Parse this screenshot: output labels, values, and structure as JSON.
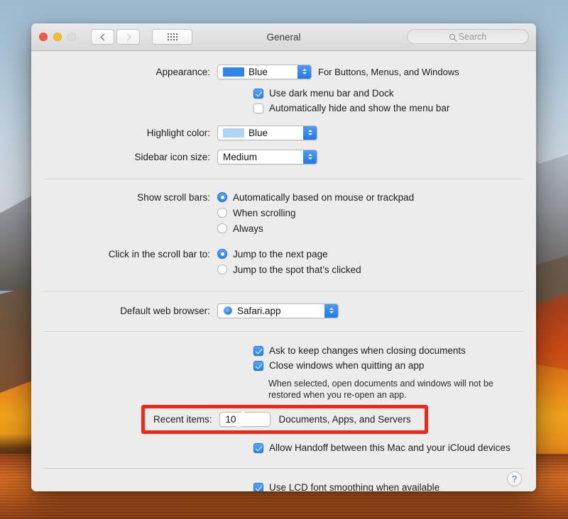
{
  "window": {
    "title": "General",
    "traffic_lights": [
      "close",
      "minimize",
      "zoom"
    ],
    "nav": {
      "back_icon": "chevron-left-icon",
      "forward_icon": "chevron-right-icon"
    },
    "show_all_icon": "grid-dots-icon",
    "search": {
      "placeholder": "Search",
      "value": "",
      "icon": "search-icon"
    }
  },
  "appearance": {
    "label": "Appearance:",
    "value": "Blue",
    "swatch_color": "#2d87e8",
    "hint": "For Buttons, Menus, and Windows",
    "dark_menu_bar": {
      "label": "Use dark menu bar and Dock",
      "checked": true
    },
    "auto_hide_menu_bar": {
      "label": "Automatically hide and show the menu bar",
      "checked": false
    }
  },
  "highlight_color": {
    "label": "Highlight color:",
    "value": "Blue",
    "swatch_color": "#b0d3f5"
  },
  "sidebar_icon_size": {
    "label": "Sidebar icon size:",
    "value": "Medium"
  },
  "show_scroll_bars": {
    "label": "Show scroll bars:",
    "options": [
      {
        "label": "Automatically based on mouse or trackpad",
        "selected": true
      },
      {
        "label": "When scrolling",
        "selected": false
      },
      {
        "label": "Always",
        "selected": false
      }
    ]
  },
  "click_scroll_bar": {
    "label": "Click in the scroll bar to:",
    "options": [
      {
        "label": "Jump to the next page",
        "selected": true
      },
      {
        "label": "Jump to the spot that’s clicked",
        "selected": false
      }
    ]
  },
  "default_web_browser": {
    "label": "Default web browser:",
    "value": "Safari.app",
    "icon": "safari-compass-icon"
  },
  "documents": {
    "ask_keep_changes": {
      "label": "Ask to keep changes when closing documents",
      "checked": true
    },
    "close_windows_quitting": {
      "label": "Close windows when quitting an app",
      "checked": true
    },
    "note": "When selected, open documents and windows will not be restored when you re-open an app."
  },
  "recent_items": {
    "label": "Recent items:",
    "value": "10",
    "hint": "Documents, Apps, and Servers",
    "highlight_color": "#f02718",
    "highlighted": true
  },
  "handoff": {
    "label": "Allow Handoff between this Mac and your iCloud devices",
    "checked": true
  },
  "lcd_font_smoothing": {
    "label": "Use LCD font smoothing when available",
    "checked": true
  },
  "help": {
    "label": "?"
  }
}
